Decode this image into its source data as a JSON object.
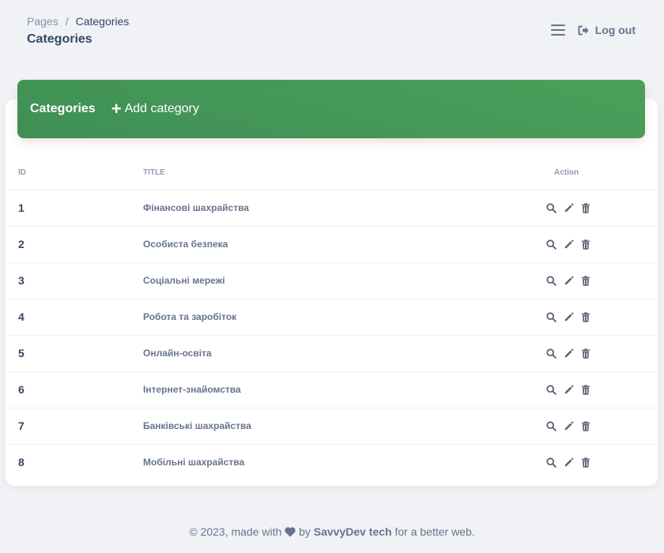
{
  "breadcrumb": {
    "root": "Pages",
    "separator": "/",
    "current": "Categories"
  },
  "page_title": "Categories",
  "header_actions": {
    "menu_icon": "hamburger-icon",
    "logout_label": "Log out"
  },
  "card": {
    "title": "Categories",
    "add_label": "Add category",
    "accent": "#43985a"
  },
  "table": {
    "columns": {
      "id": "ID",
      "title": "TITLE",
      "action": "Action"
    },
    "rows": [
      {
        "id": "1",
        "title": "Фінансові шахрайства"
      },
      {
        "id": "2",
        "title": "Особиста безпека"
      },
      {
        "id": "3",
        "title": "Соціальні мережі"
      },
      {
        "id": "4",
        "title": "Робота та заробіток"
      },
      {
        "id": "5",
        "title": "Онлайн-освіта"
      },
      {
        "id": "6",
        "title": "Інтернет-знайомства"
      },
      {
        "id": "7",
        "title": "Банківські шахрайства"
      },
      {
        "id": "8",
        "title": "Мобільні шахрайства"
      }
    ]
  },
  "footer": {
    "prefix": "© 2023, made with",
    "by": "by",
    "brand": "SavvyDev tech",
    "suffix": "for a better web."
  }
}
